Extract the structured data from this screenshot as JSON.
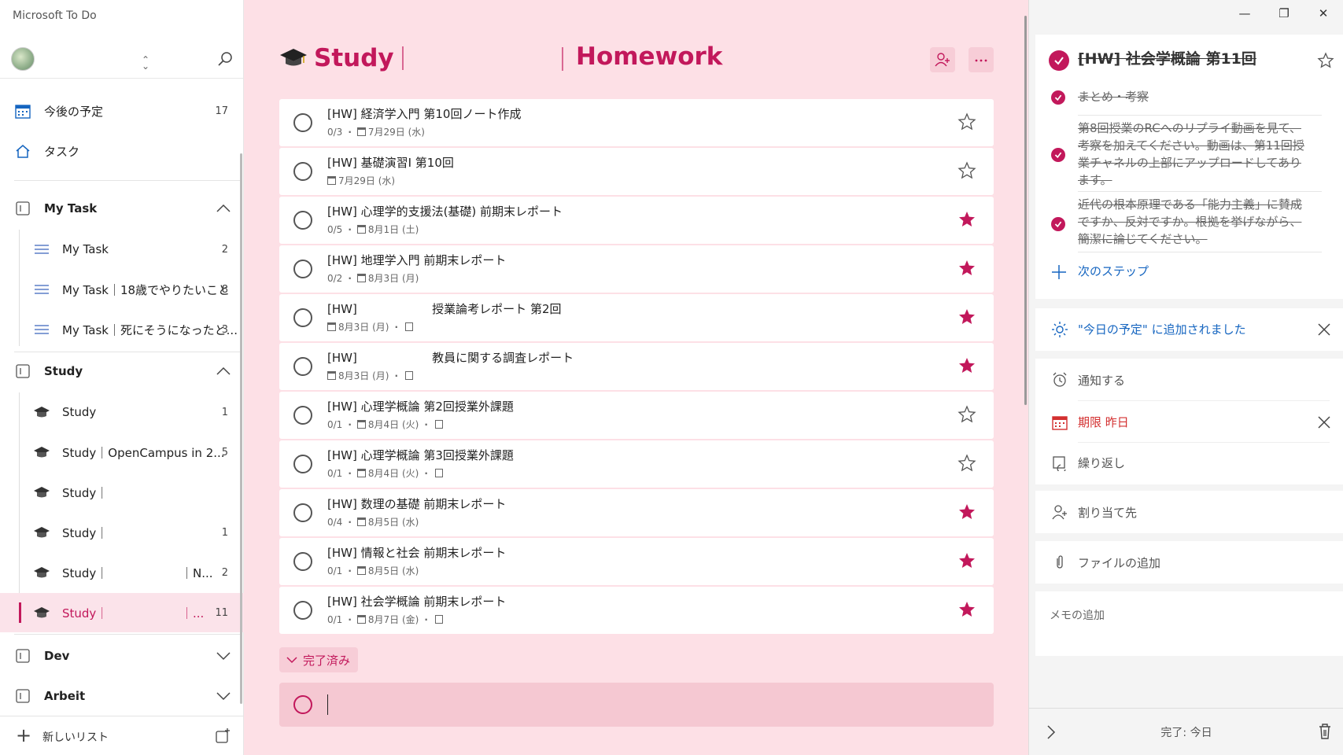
{
  "window": {
    "app_title": "Microsoft To Do",
    "controls": [
      "—",
      "❐",
      "✕"
    ]
  },
  "sidebar": {
    "smart_lists": [
      {
        "label": "今後の予定",
        "count": "17",
        "icon": "calendar-icon"
      },
      {
        "label": "タスク",
        "count": "",
        "icon": "home-icon"
      }
    ],
    "groups": [
      {
        "label": "My Task",
        "expanded": true,
        "items": [
          {
            "label": "My Task",
            "count": "2"
          },
          {
            "label": "My Task｜18歳でやりたいこと",
            "count": "8"
          },
          {
            "label": "My Task｜死にそうになったと...",
            "count": "3"
          }
        ]
      },
      {
        "label": "Study",
        "expanded": true,
        "items": [
          {
            "label": "Study",
            "count": "1"
          },
          {
            "label": "Study｜OpenCampus in 2...",
            "count": "5"
          },
          {
            "label": "Study｜",
            "count": ""
          },
          {
            "label": "Study｜",
            "count": "1"
          },
          {
            "label": "Study｜",
            "suffix": "｜N...",
            "count": "2"
          },
          {
            "label": "Study｜",
            "suffix": "｜...",
            "count": "11",
            "active": true
          }
        ]
      },
      {
        "label": "Dev",
        "expanded": false
      },
      {
        "label": "Arbeit",
        "expanded": false
      }
    ],
    "new_list_label": "新しいリスト"
  },
  "main": {
    "title": "Study",
    "subtitle": "Homework",
    "tasks": [
      {
        "title": "[HW] 経済学入門 第10回ノート作成",
        "steps": "0/3",
        "due": "7月29日 (水)",
        "note": false,
        "starred": false
      },
      {
        "title": "[HW] 基礎演習Ⅰ 第10回",
        "steps": "",
        "due": "7月29日 (水)",
        "note": false,
        "starred": false
      },
      {
        "title": "[HW] 心理学的支援法(基礎) 前期末レポート",
        "steps": "0/5",
        "due": "8月1日 (土)",
        "note": false,
        "starred": true
      },
      {
        "title": "[HW] 地理学入門 前期末レポート",
        "steps": "0/2",
        "due": "8月3日 (月)",
        "note": false,
        "starred": true
      },
      {
        "title": "[HW]                    授業論考レポート 第2回",
        "steps": "",
        "due": "8月3日 (月)",
        "note": true,
        "starred": true
      },
      {
        "title": "[HW]                    教員に関する調査レポート",
        "steps": "",
        "due": "8月3日 (月)",
        "note": true,
        "starred": true
      },
      {
        "title": "[HW] 心理学概論 第2回授業外課題",
        "steps": "0/1",
        "due": "8月4日 (火)",
        "note": true,
        "starred": false
      },
      {
        "title": "[HW] 心理学概論 第3回授業外課題",
        "steps": "0/1",
        "due": "8月4日 (火)",
        "note": true,
        "starred": false
      },
      {
        "title": "[HW] 数理の基礎 前期末レポート",
        "steps": "0/4",
        "due": "8月5日 (水)",
        "note": false,
        "starred": true
      },
      {
        "title": "[HW] 情報と社会 前期末レポート",
        "steps": "0/1",
        "due": "8月5日 (水)",
        "note": false,
        "starred": true
      },
      {
        "title": "[HW] 社会学概論 前期末レポート",
        "steps": "0/1",
        "due": "8月7日 (金)",
        "note": true,
        "starred": true
      }
    ],
    "completed_label": "完了済み"
  },
  "detail": {
    "title": "[HW] 社会学概論 第11回",
    "steps": [
      "まとめ・考察",
      "第8回授業のRCへのリプライ動画を見て、考察を加えてください。動画は、第11回授業チャネルの上部にアップロードしてあります。",
      "近代の根本原理である「能力主義」に賛成ですか、反対ですか。根拠を挙げながら、簡潔に論じてください。"
    ],
    "next_step_label": "次のステップ",
    "my_day_label": "\"今日の予定\" に追加されました",
    "remind_label": "通知する",
    "due_label": "期限 昨日",
    "repeat_label": "繰り返し",
    "assign_label": "割り当て先",
    "file_label": "ファイルの追加",
    "memo_label": "メモの追加",
    "completed_footer": "完了: 今日"
  },
  "colors": {
    "accent": "#c2185b",
    "main_bg": "#fde0e6",
    "link_blue": "#1565c0"
  }
}
